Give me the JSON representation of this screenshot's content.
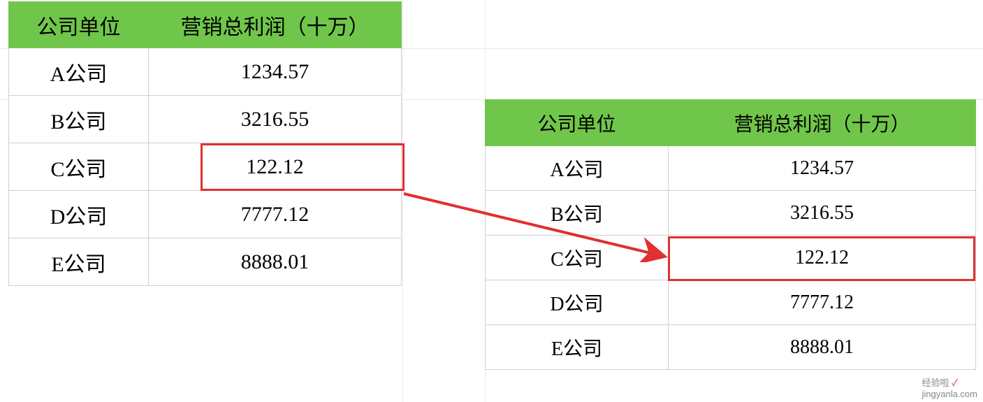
{
  "table1": {
    "headers": [
      "公司单位",
      "营销总利润（十万）"
    ],
    "rows": [
      [
        "A公司",
        "1234.57"
      ],
      [
        "B公司",
        "3216.55"
      ],
      [
        "C公司",
        "122.12"
      ],
      [
        "D公司",
        "7777.12"
      ],
      [
        "E公司",
        "8888.01"
      ]
    ]
  },
  "table2": {
    "headers": [
      "公司单位",
      "营销总利润（十万）"
    ],
    "rows": [
      [
        "A公司",
        "1234.57"
      ],
      [
        "B公司",
        "3216.55"
      ],
      [
        "C公司",
        "122.12"
      ],
      [
        "D公司",
        "7777.12"
      ],
      [
        "E公司",
        "8888.01"
      ]
    ]
  },
  "watermark": {
    "text": "经验啦",
    "sub": "jingyanla.com",
    "check": "✓"
  },
  "chart_data": [
    {
      "type": "table",
      "title": "",
      "columns": [
        "公司单位",
        "营销总利润（十万）"
      ],
      "rows": [
        {
          "公司单位": "A公司",
          "营销总利润（十万）": 1234.57
        },
        {
          "公司单位": "B公司",
          "营销总利润（十万）": 3216.55
        },
        {
          "公司单位": "C公司",
          "营销总利润（十万）": 122.12
        },
        {
          "公司单位": "D公司",
          "营销总利润（十万）": 7777.12
        },
        {
          "公司单位": "E公司",
          "营销总利润（十万）": 8888.01
        }
      ]
    },
    {
      "type": "table",
      "title": "",
      "columns": [
        "公司单位",
        "营销总利润（十万）"
      ],
      "rows": [
        {
          "公司单位": "A公司",
          "营销总利润（十万）": 1234.57
        },
        {
          "公司单位": "B公司",
          "营销总利润（十万）": 3216.55
        },
        {
          "公司单位": "C公司",
          "营销总利润（十万）": 122.12
        },
        {
          "公司单位": "D公司",
          "营销总利润（十万）": 7777.12
        },
        {
          "公司单位": "E公司",
          "营销总利润（十万）": 8888.01
        }
      ]
    }
  ]
}
